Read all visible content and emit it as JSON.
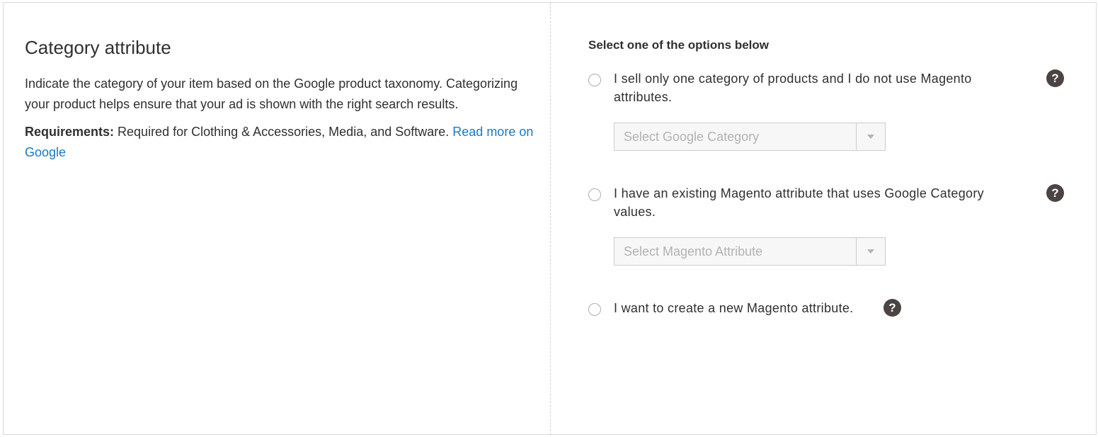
{
  "left": {
    "title": "Category attribute",
    "description": "Indicate the category of your item based on the Google product taxonomy. Categorizing your product helps ensure that your ad is shown with the right search results.",
    "requirements_label": "Requirements:",
    "requirements_text": " Required for Clothing & Accessories, Media, and Software. ",
    "read_more_link": "Read more on Google"
  },
  "right": {
    "heading": "Select one of the options below",
    "options": [
      {
        "label": "I sell only one category of products and I do not use Magento attributes.",
        "select_placeholder": "Select Google Category"
      },
      {
        "label": "I have an existing Magento attribute that uses Google Category values.",
        "select_placeholder": "Select Magento Attribute"
      },
      {
        "label": "I want to create a new Magento attribute."
      }
    ],
    "help_glyph": "?"
  },
  "icons": {
    "help": "question-mark-circle-icon",
    "dropdown": "chevron-down-icon"
  },
  "colors": {
    "link": "#1979c3",
    "help_icon_bg": "#4a4542",
    "text": "#303030",
    "placeholder": "#b3b3b3"
  }
}
